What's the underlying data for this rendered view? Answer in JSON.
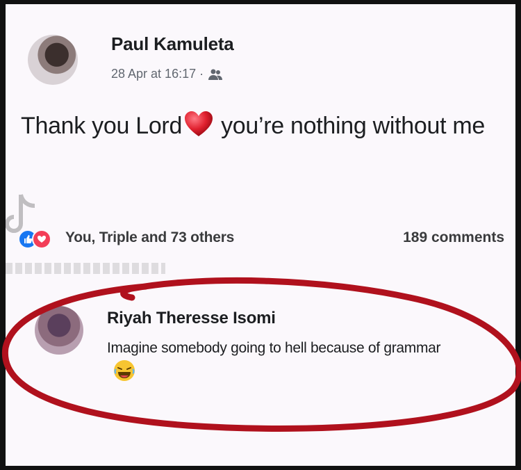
{
  "post": {
    "author": "Paul Kamuleta",
    "date": "28 Apr at 16:17 ·",
    "privacy_icon": "friends-icon",
    "text": "Thank you Lord",
    "emoji": "heart-emoji",
    "text_after": "you’re nothing without me"
  },
  "reactions": {
    "icons": [
      "like-icon",
      "love-icon"
    ],
    "text": "You, Triple and 73 others",
    "comments": "189 comments"
  },
  "comment": {
    "author": "Riyah Theresse Isomi",
    "text": "Imagine somebody going to hell because of grammar",
    "emoji": "laughing-emoji"
  },
  "colors": {
    "highlight": "#b0111d",
    "like": "#1877f2",
    "love": "#f33e58"
  }
}
